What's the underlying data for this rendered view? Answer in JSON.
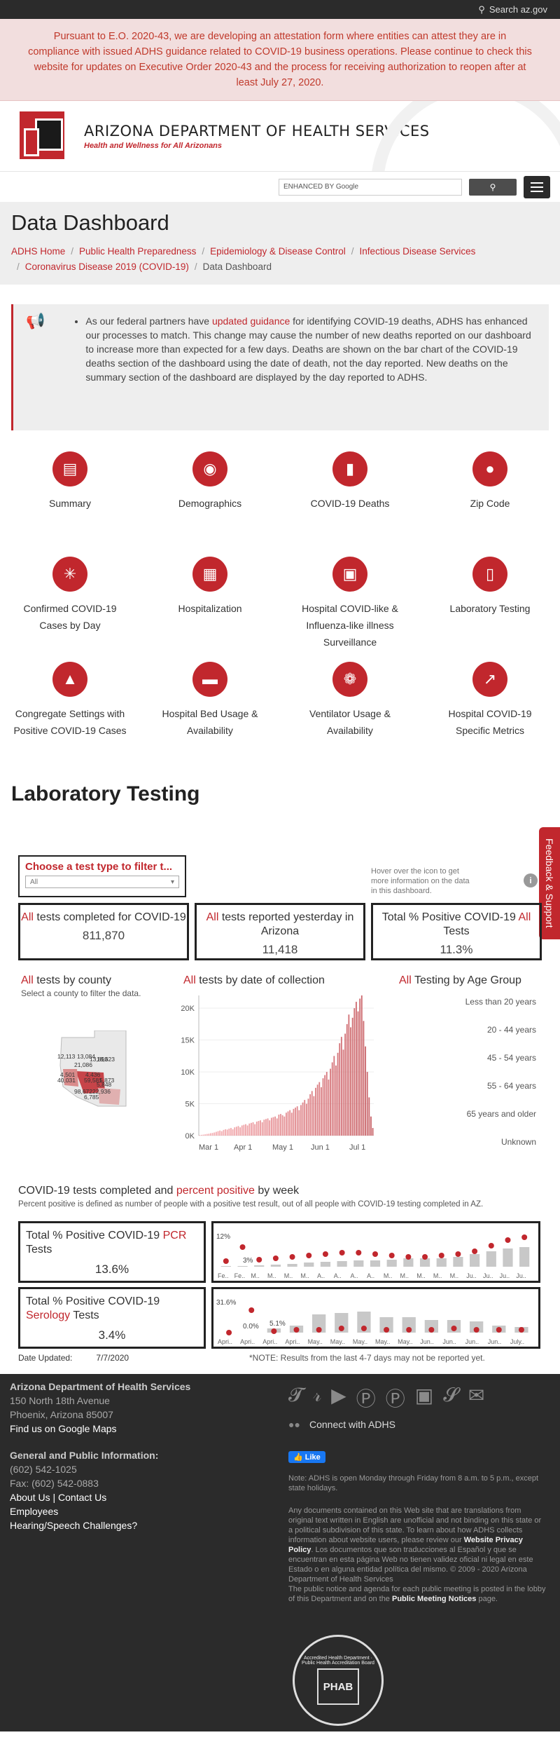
{
  "topbar": {
    "search_label": "Search az.gov"
  },
  "alert": {
    "pre": "Pursuant to ",
    "link": "E.O. 2020-43",
    "post": ", we are developing an attestation form where entities can attest they are in compliance with issued ADHS guidance related to COVID-19 business operations. Please continue to check this website for updates on Executive Order 2020-43 and the process for receiving authorization to reopen after at least July 27, 2020."
  },
  "header": {
    "org": "ARIZONA DEPARTMENT OF HEALTH SERVICES",
    "tagline": "Health and Wellness for All Arizonans"
  },
  "search": {
    "placeholder": "ENHANCED BY Google"
  },
  "page": {
    "title": "Data Dashboard"
  },
  "breadcrumb": [
    "ADHS Home",
    "Public Health Preparedness",
    "Epidemiology & Disease Control",
    "Infectious Disease Services",
    "Coronavirus Disease 2019 (COVID-19)",
    "Data Dashboard"
  ],
  "notice": {
    "pre": "As our federal partners have ",
    "link": "updated guidance",
    "post": " for identifying COVID-19 deaths, ADHS has enhanced our processes to match. This change may cause the number of new deaths reported on our dashboard to increase more than expected for a few days. Deaths are shown on the bar chart of the COVID-19 deaths section of the dashboard using the date of death, not the day reported. New deaths on the summary section of the dashboard are displayed by the day reported to ADHS."
  },
  "tiles": [
    {
      "label": "Summary",
      "icon": "document-icon"
    },
    {
      "label": "Demographics",
      "icon": "group-icon"
    },
    {
      "label": "COVID-19 Deaths",
      "icon": "bar-chart-icon"
    },
    {
      "label": "Zip Code",
      "icon": "location-pin-icon"
    },
    {
      "label": "Confirmed COVID-19 Cases by Day",
      "icon": "network-icon"
    },
    {
      "label": "Hospitalization",
      "icon": "hospital-beds-icon"
    },
    {
      "label": "Hospital COVID-like & Influenza-like illness Surveillance",
      "icon": "building-icon"
    },
    {
      "label": "Laboratory Testing",
      "icon": "test-tubes-icon"
    },
    {
      "label": "Congregate Settings with Positive COVID-19 Cases",
      "icon": "microscope-icon"
    },
    {
      "label": "Hospital Bed Usage & Availability",
      "icon": "hospital-bed-icon"
    },
    {
      "label": "Ventilator Usage & Availability",
      "icon": "lungs-icon"
    },
    {
      "label": "Hospital COVID-19 Specific Metrics",
      "icon": "trend-chart-icon"
    }
  ],
  "section": {
    "title": "Laboratory Testing"
  },
  "feedback": {
    "label": "Feedback & Support"
  },
  "filter": {
    "heading": "Choose a test type to filter t...",
    "selected": "All"
  },
  "hover_hint": "Hover over the icon to get more information on the data in this dashboard.",
  "kpis": [
    {
      "red": "All",
      "text": " tests completed for COVID-19",
      "value": "811,870"
    },
    {
      "red": "All",
      "text": " tests reported yesterday in Arizona",
      "value": "11,418"
    },
    {
      "text": "Total % Positive COVID-19 ",
      "red": "All",
      "text2": " Tests",
      "value": "11.3%"
    }
  ],
  "county": {
    "red": "All",
    "title": " tests by county",
    "note": "Select a county to filter the data.",
    "labels": [
      "12,113",
      "13,084",
      "13,893",
      "18,623",
      "21,086",
      "4,501",
      "4,436",
      "40,031",
      "59,581",
      "98,672",
      "6,785",
      "22,936",
      "5,873",
      "5,848"
    ]
  },
  "collection": {
    "red": "All",
    "title": " tests by date of collection"
  },
  "agegroup": {
    "red": "All",
    "title": " Testing by Age Group",
    "groups": [
      "Less than 20 years",
      "20 - 44 years",
      "45 - 54 years",
      "55 - 64 years",
      "65 years and older",
      "Unknown"
    ]
  },
  "weekly": {
    "title_a": "COVID-19 tests completed",
    "title_b": " and ",
    "title_c": "percent positive",
    "title_d": " by week",
    "note": "Percent positive is defined as number of people with a positive test result, out of all people with COVID-19 testing completed in AZ."
  },
  "pcr": {
    "pre": "Total % Positive COVID-19 ",
    "red": "PCR",
    "post": " Tests",
    "value": "13.6%",
    "axis": [
      "Fe..",
      "Fe..",
      "M..",
      "M..",
      "M..",
      "M..",
      "A..",
      "A..",
      "A..",
      "A..",
      "M..",
      "M..",
      "M..",
      "M..",
      "M..",
      "Ju..",
      "Ju..",
      "Ju..",
      "Ju.."
    ],
    "annot": [
      "12%",
      "3%"
    ]
  },
  "serology": {
    "pre": "Total % Positive COVID-19 ",
    "red": "Serology",
    "post": " Tests",
    "value": "3.4%",
    "axis": [
      "Apri..",
      "Apri..",
      "Apri..",
      "Apri..",
      "May..",
      "May..",
      "May..",
      "May..",
      "May..",
      "Jun..",
      "Jun..",
      "Jun..",
      "Jun..",
      "July.."
    ],
    "annot": [
      "31.6%",
      "0.0%",
      "5.1%"
    ]
  },
  "updated": {
    "label": "Date Updated:",
    "value": "7/7/2020"
  },
  "disclaimer": "*NOTE: Results from the last 4-7 days may not be reported yet.",
  "chart_data": {
    "type": "bar",
    "title": "All tests by date of collection",
    "x_ticks": [
      "Mar 1",
      "Apr 1",
      "May 1",
      "Jun 1",
      "Jul 1"
    ],
    "y_ticks": [
      "0K",
      "5K",
      "10K",
      "15K",
      "20K"
    ],
    "ylim": [
      0,
      22000
    ],
    "values": [
      80,
      120,
      160,
      200,
      260,
      300,
      380,
      420,
      500,
      600,
      700,
      800,
      700,
      900,
      1000,
      950,
      1100,
      1200,
      1000,
      1300,
      1400,
      1500,
      1300,
      1600,
      1700,
      1800,
      1600,
      1900,
      2000,
      2100,
      1800,
      2200,
      2300,
      2400,
      2100,
      2500,
      2600,
      2700,
      2400,
      2800,
      2900,
      3000,
      2700,
      3300,
      3400,
      3200,
      3000,
      3600,
      3800,
      4000,
      3600,
      4200,
      4400,
      4600,
      4000,
      4800,
      5200,
      5600,
      5000,
      5800,
      6500,
      7000,
      6200,
      7500,
      8000,
      8400,
      7600,
      9000,
      9500,
      10000,
      8800,
      10500,
      11500,
      12500,
      11000,
      13000,
      14500,
      15500,
      13500,
      16000,
      17500,
      19000,
      17000,
      18500,
      20000,
      21000,
      19500,
      21500,
      22000,
      18000,
      14000,
      10000,
      6000,
      3000,
      1200
    ]
  },
  "footer": {
    "org": "Arizona Department of Health Services",
    "addr1": "150 North 18th Avenue",
    "addr2": "Phoenix, Arizona 85007",
    "maps": "Find us on Google Maps",
    "gen": "General and Public Information:",
    "phone": "(602) 542-1025",
    "fax": "Fax: (602) 542-0883",
    "about": "About Us",
    "contact": "Contact Us",
    "employees": "Employees",
    "hearing": "Hearing/Speech Challenges?",
    "connect": "Connect with ADHS",
    "like": "Like",
    "hours": "Note: ADHS is open Monday through Friday from 8 a.m. to 5 p.m., except state holidays.",
    "legal_pre": "Any documents contained on this Web site that are translations from original text written in English are unofficial and not binding on this state or a political subdivision of this state. To learn about how ADHS collects information about website users, please review our ",
    "legal_link": "Website Privacy Policy",
    "legal_post": ". Los documentos que son traducciones al Español y que se encuentran en esta página Web no tienen validez oficial ni legal en este Estado o en alguna entidad política del mismo. © 2009 - 2020 Arizona Department of Health Services",
    "meet_pre": "The public notice and agenda for each public meeting is posted in the lobby of this Department and on the ",
    "meet_link": "Public Meeting Notices",
    "meet_post": " page.",
    "phab": "PHAB",
    "phab_ring": "Accredited Health Department · Public Health Accreditation Board"
  }
}
